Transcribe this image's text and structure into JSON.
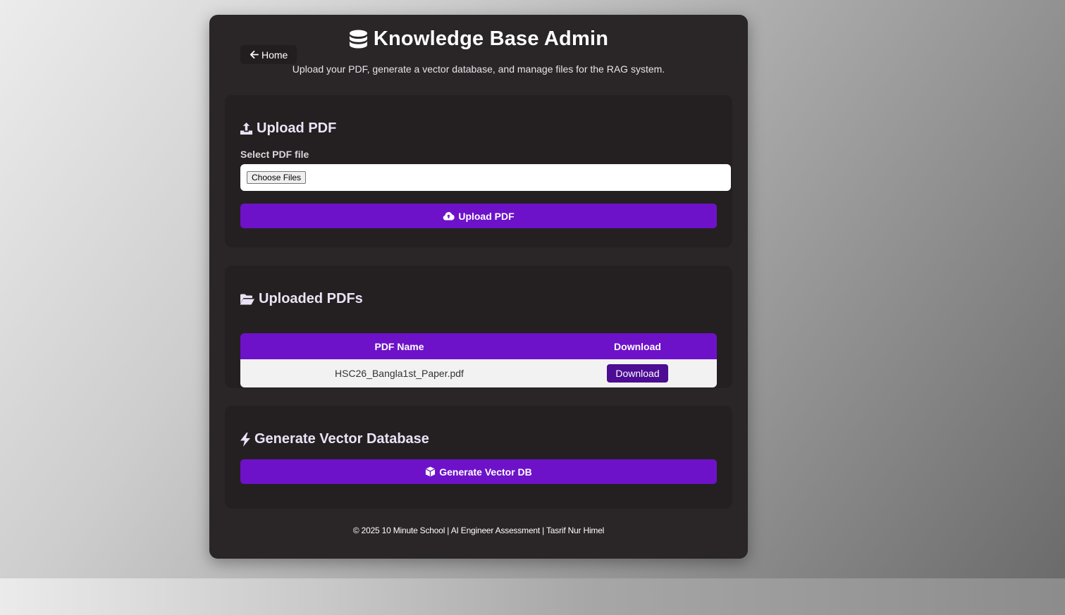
{
  "header": {
    "home_label": "Home",
    "title": "Knowledge Base Admin",
    "subtitle": "Upload your PDF, generate a vector database, and manage files for the RAG system."
  },
  "upload": {
    "title": "Upload PDF",
    "field_label": "Select PDF file",
    "choose_label": "Choose Files",
    "button_label": "Upload PDF"
  },
  "uploaded": {
    "title": "Uploaded PDFs",
    "columns": [
      "PDF Name",
      "Download"
    ],
    "rows": [
      {
        "name": "HSC26_Bangla1st_Paper.pdf",
        "action": "Download"
      }
    ]
  },
  "generate": {
    "title": "Generate Vector Database",
    "button_label": "Generate Vector DB"
  },
  "footer": {
    "text": "© 2025 10 Minute School | AI Engineer Assessment | Tasrif Nur Himel"
  },
  "colors": {
    "accent": "#6d12c9",
    "accent_dark": "#4c0c93",
    "panel": "#2a2527",
    "card": "#242021"
  },
  "icons": {
    "home": "arrow-left-icon",
    "title": "database-icon",
    "upload_section": "upload-icon",
    "upload_button": "cloud-upload-icon",
    "uploaded_section": "folder-open-icon",
    "generate_section": "bolt-icon",
    "generate_button": "cube-icon"
  }
}
